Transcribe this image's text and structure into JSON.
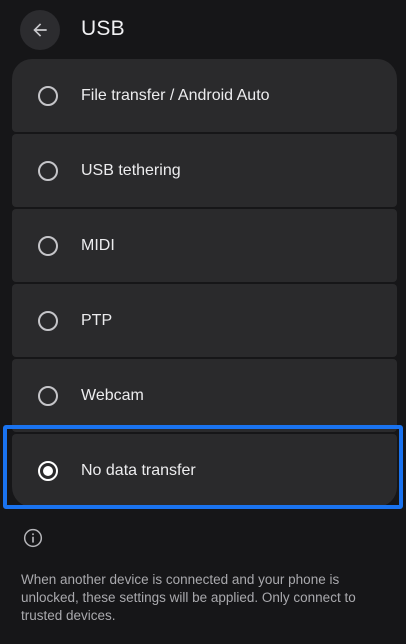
{
  "header": {
    "back_icon": "arrow-left-icon",
    "title": "USB"
  },
  "options": [
    {
      "label": "File transfer / Android Auto",
      "selected": false
    },
    {
      "label": "USB tethering",
      "selected": false
    },
    {
      "label": "MIDI",
      "selected": false
    },
    {
      "label": "PTP",
      "selected": false
    },
    {
      "label": "Webcam",
      "selected": false
    },
    {
      "label": "No data transfer",
      "selected": true
    }
  ],
  "footer": {
    "info_icon": "info-icon",
    "text": "When another device is connected and your phone is unlocked, these settings will be applied. Only connect to trusted devices."
  },
  "colors": {
    "background": "#161618",
    "card": "#2a2a2c",
    "highlight": "#1a73f0"
  }
}
